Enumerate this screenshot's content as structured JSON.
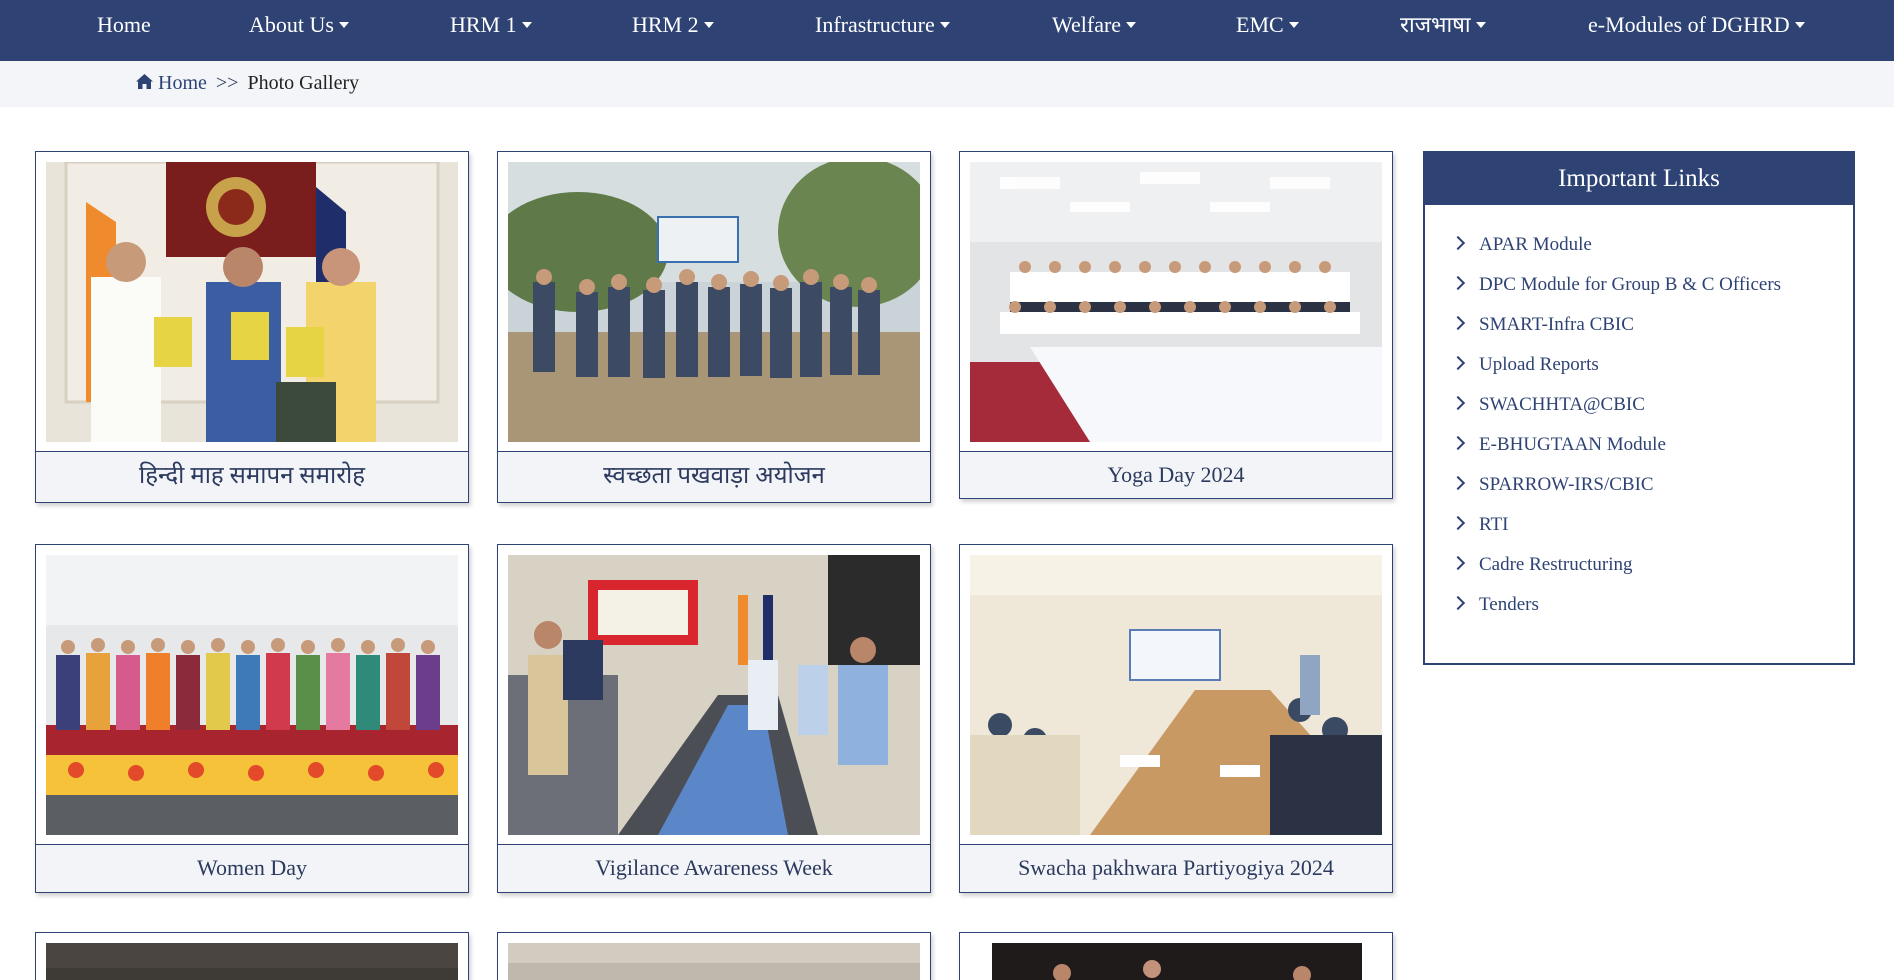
{
  "nav": {
    "items": [
      {
        "label": "Home",
        "dropdown": false
      },
      {
        "label": "About Us",
        "dropdown": true
      },
      {
        "label": "HRM 1",
        "dropdown": true
      },
      {
        "label": "HRM 2",
        "dropdown": true
      },
      {
        "label": "Infrastructure",
        "dropdown": true
      },
      {
        "label": "Welfare",
        "dropdown": true
      },
      {
        "label": "EMC",
        "dropdown": true
      },
      {
        "label": "राजभाषा",
        "dropdown": true
      },
      {
        "label": "e-Modules of DGHRD",
        "dropdown": true
      }
    ]
  },
  "breadcrumb": {
    "home": "Home",
    "separator": ">>",
    "current": "Photo Gallery",
    "icon": "home-icon"
  },
  "gallery": {
    "cards": [
      {
        "caption": "हिन्दी माह समापन समारोह",
        "photo": "book-release-ceremony"
      },
      {
        "caption": "स्वच्छता पखवाड़ा अयोजन",
        "photo": "outdoor-group-cleanliness"
      },
      {
        "caption": "Yoga Day 2024",
        "photo": "yoga-group-hall"
      },
      {
        "caption": "Women Day",
        "photo": "women-group-flowers"
      },
      {
        "caption": "Vigilance Awareness Week",
        "photo": "vigilance-pledge-meeting"
      },
      {
        "caption": "Swacha pakhwara Partiyogiya 2024",
        "photo": "conference-competition"
      },
      {
        "caption": "",
        "photo": "partial-photo"
      },
      {
        "caption": "",
        "photo": "partial-photo"
      },
      {
        "caption": "",
        "photo": "partial-photo"
      }
    ]
  },
  "links": {
    "title": "Important Links",
    "items": [
      "APAR Module",
      "DPC Module for Group B & C Officers",
      "SMART-Infra CBIC",
      "Upload Reports",
      "SWACHHTA@CBIC",
      "E-BHUGTAAN Module",
      "SPARROW-IRS/CBIC",
      "RTI",
      "Cadre Restructuring",
      "Tenders"
    ]
  },
  "colors": {
    "navbar": "#2e4374",
    "breadcrumb_bg": "#f3f5f8",
    "text": "#2b3a5e",
    "caption_bg": "#f3f4f7"
  }
}
